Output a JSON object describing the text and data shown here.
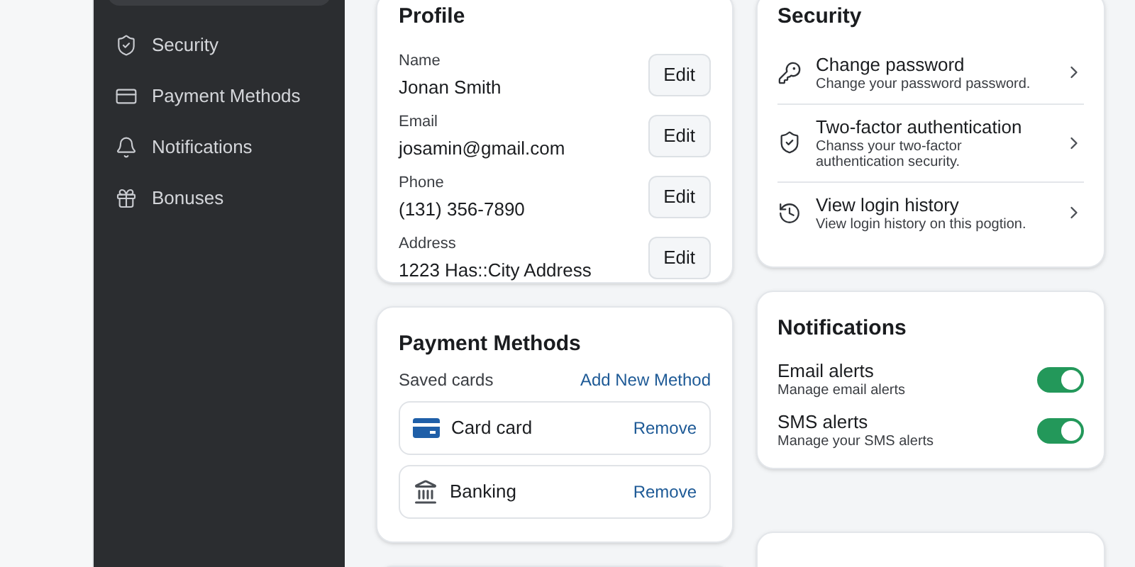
{
  "sidebar": {
    "items": [
      {
        "kind": "shield",
        "label": "Security",
        "selected": false
      },
      {
        "kind": "card",
        "label": "Payment Methods",
        "selected": false
      },
      {
        "kind": "bell",
        "label": "Notifications",
        "selected": false
      },
      {
        "kind": "gift",
        "label": "Bonuses",
        "selected": false
      }
    ]
  },
  "profile": {
    "title": "Profile",
    "fields": [
      {
        "label": "Name",
        "value": "Jonan Smith",
        "button": "Edit"
      },
      {
        "label": "Email",
        "value": "josamin@gmail.com",
        "button": "Edit"
      },
      {
        "label": "Phone",
        "value": "(131) 356-7890",
        "button": "Edit"
      },
      {
        "label": "Address",
        "value": "1223 Has::City Address",
        "button": "Edit"
      }
    ]
  },
  "security": {
    "title": "Security",
    "items": [
      {
        "kind": "key",
        "title": "Change password",
        "description": "Change your password password."
      },
      {
        "kind": "shield",
        "title": "Two-factor authentication",
        "description": "Chanss your two-factor authentication security."
      },
      {
        "kind": "history",
        "title": "View login history",
        "description": "View login history on this pogtion."
      }
    ]
  },
  "payment": {
    "title": "Payment Methods",
    "subtitle": "Saved cards",
    "add_link": "Add New Method",
    "methods": [
      {
        "kind": "card",
        "label": "Card card",
        "action": "Remove"
      },
      {
        "kind": "bank",
        "label": "Banking",
        "action": "Remove"
      }
    ]
  },
  "notifications": {
    "title": "Notifications",
    "items": [
      {
        "title": "Email alerts",
        "description": "Manage email alerts",
        "on": true
      },
      {
        "title": "SMS alerts",
        "description": "Manage your SMS alerts",
        "on": true
      }
    ]
  }
}
